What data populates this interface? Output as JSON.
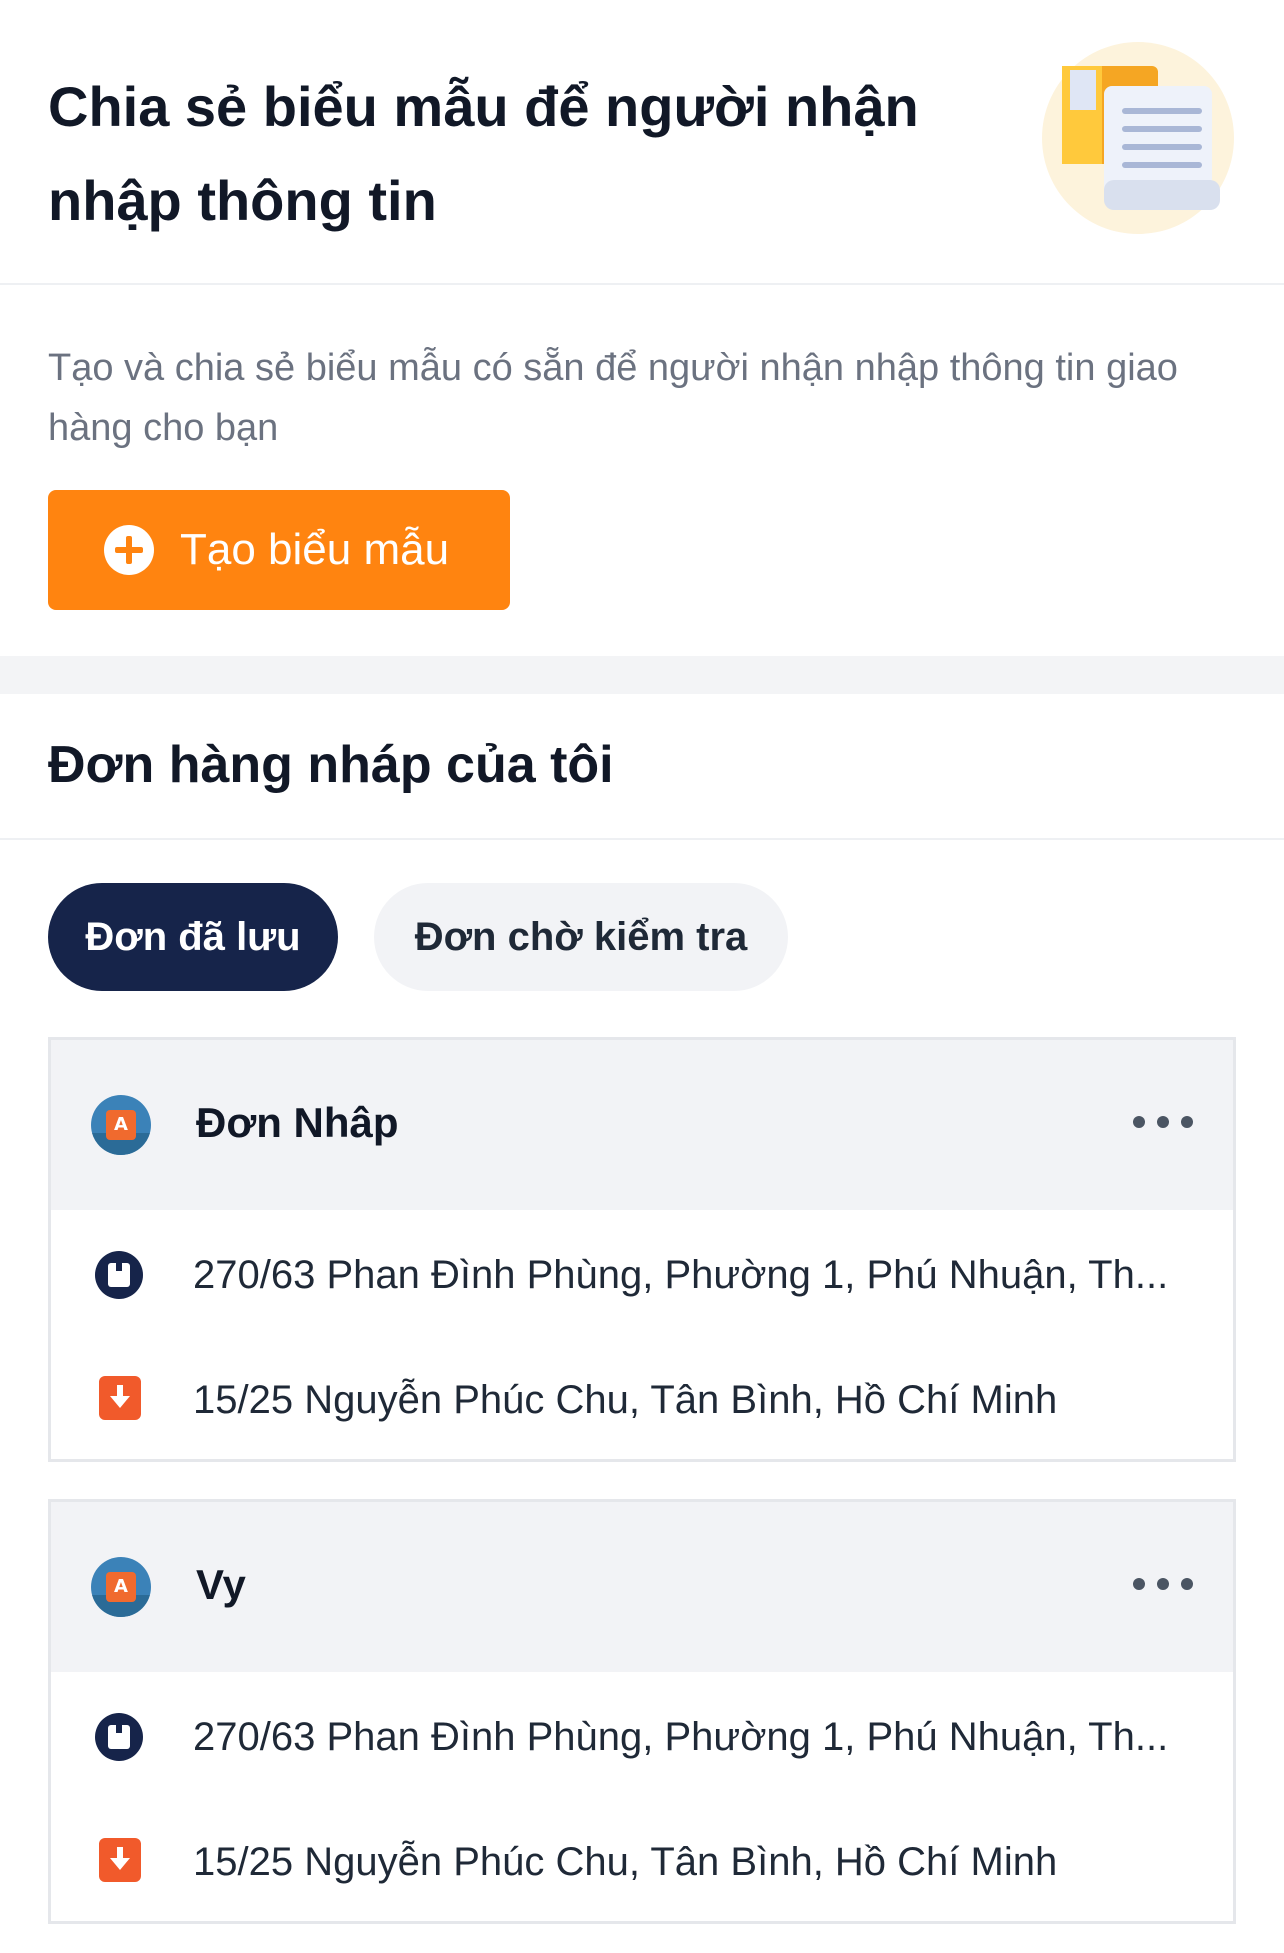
{
  "share_form": {
    "title": "Chia sẻ biểu mẫu để người nhận nhập thông tin",
    "description": "Tạo và chia sẻ biểu mẫu có sẵn để người nhận nhập thông tin giao hàng cho bạn",
    "create_button_label": "Tạo biểu mẫu",
    "illustration_icon": "document-scroll-icon"
  },
  "drafts": {
    "title": "Đơn hàng nháp của tôi",
    "tabs": [
      {
        "label": "Đơn đã lưu",
        "selected": true
      },
      {
        "label": "Đơn chờ kiểm tra",
        "selected": false
      }
    ],
    "orders": [
      {
        "name": "Đơn Nhâp",
        "pickup_address": "270/63 Phan Đình Phùng, Phường 1, Phú Nhuận, Th...",
        "dropoff_address": "15/25 Nguyễn Phúc Chu,  Tân Bình,  Hồ Chí Minh"
      },
      {
        "name": "Vy",
        "pickup_address": "270/63 Phan Đình Phùng, Phường 1, Phú Nhuận, Th...",
        "dropoff_address": "15/25 Nguyễn Phúc Chu,  Tân Bình,  Hồ Chí Minh"
      }
    ]
  },
  "colors": {
    "accent": "#ff8410",
    "navy": "#16244a",
    "dropoff": "#f15a2b"
  }
}
